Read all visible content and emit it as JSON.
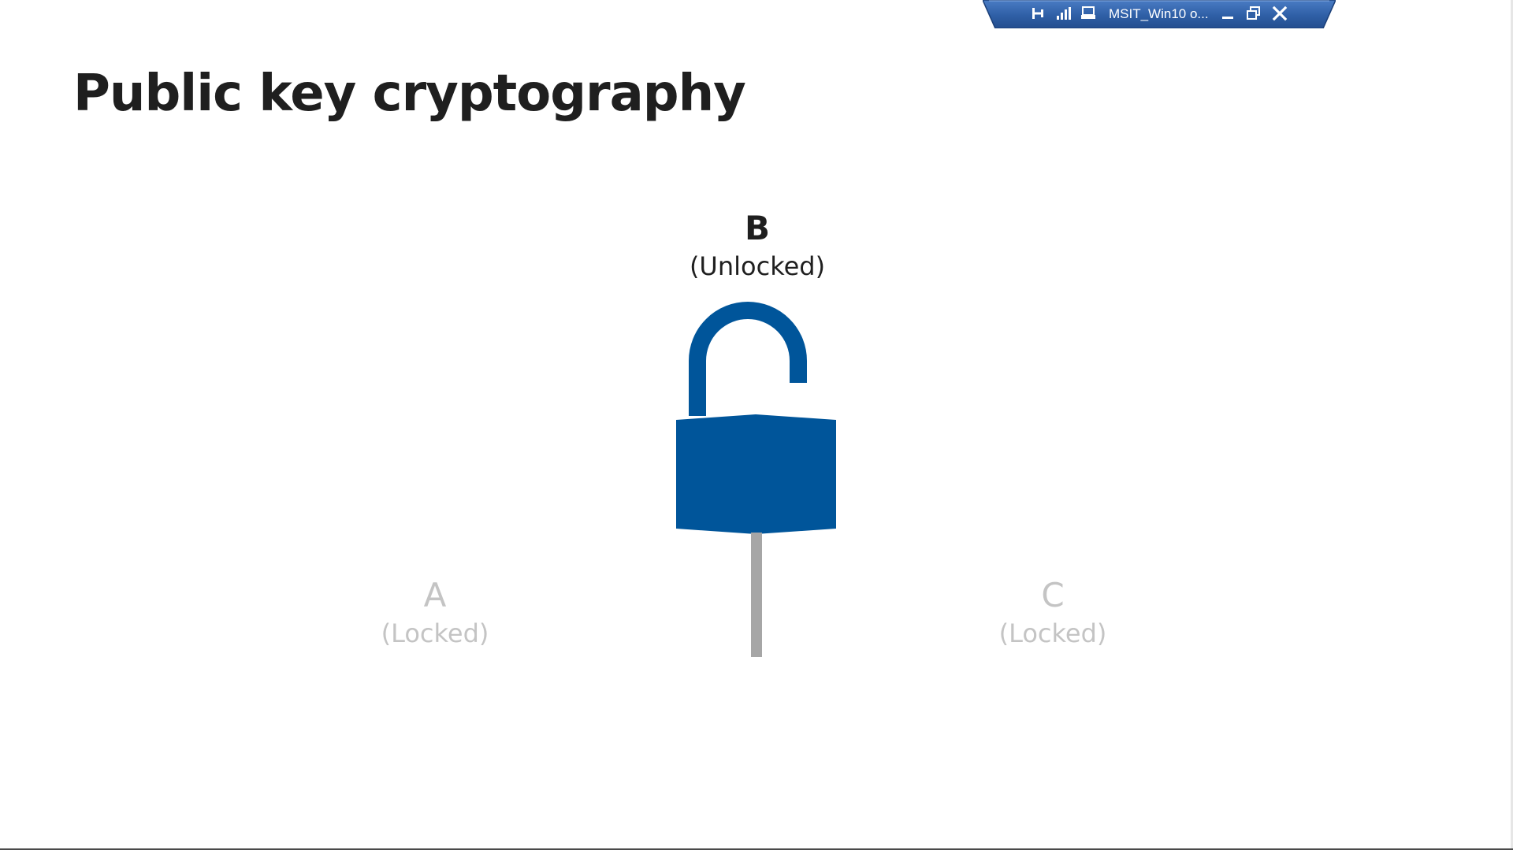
{
  "remote_bar": {
    "title": "MSIT_Win10 o...",
    "icons": [
      "pin-icon",
      "signal-strength-icon",
      "remote-computer-icon",
      "minimize-icon",
      "restore-icon",
      "close-icon"
    ],
    "background_color": "#2f5fa6"
  },
  "slide": {
    "title": "Public key cryptography",
    "nodes": {
      "b": {
        "letter": "B",
        "state": "(Unlocked)"
      },
      "a": {
        "letter": "A",
        "state": "(Locked)"
      },
      "c": {
        "letter": "C",
        "state": "(Locked)"
      }
    },
    "lock": {
      "icon": "unlocked-padlock-icon",
      "color": "#00559a",
      "post_color": "#a6a6a6"
    }
  }
}
